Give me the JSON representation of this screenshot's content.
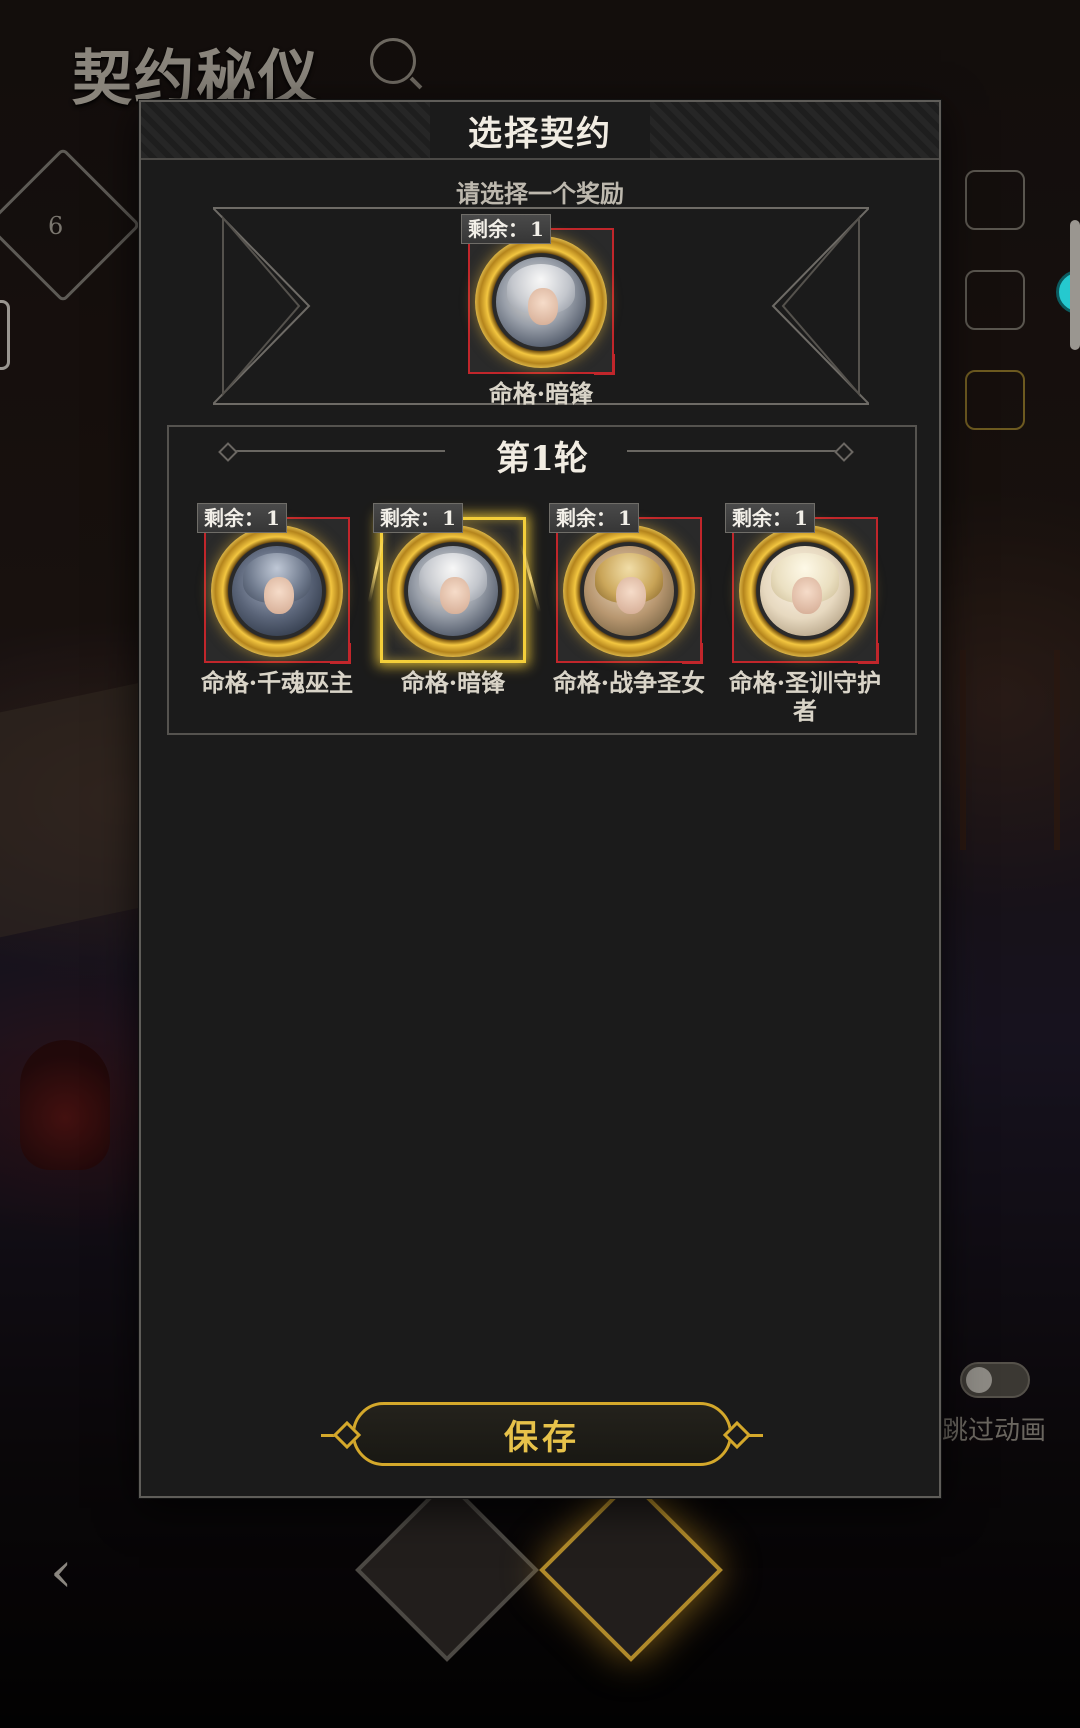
{
  "background": {
    "title": "契约秘仪",
    "emblem_number": "6",
    "skip_animation_label": "跳过动画"
  },
  "dialog": {
    "title": "选择契约",
    "prompt": "请选择一个奖励",
    "selected_reward": {
      "remaining_label": "剩余：",
      "remaining_value": "1",
      "name": "命格·暗锋"
    },
    "round": {
      "title": "第1轮",
      "options": [
        {
          "remaining_label": "剩余：",
          "remaining_value": "1",
          "name": "命格·千魂巫主",
          "icon": "portrait-dark-mage"
        },
        {
          "remaining_label": "剩余：",
          "remaining_value": "1",
          "name": "命格·暗锋",
          "icon": "portrait-silver-hair",
          "selected": true
        },
        {
          "remaining_label": "剩余：",
          "remaining_value": "1",
          "name": "命格·战争圣女",
          "icon": "portrait-war-maiden"
        },
        {
          "remaining_label": "剩余：",
          "remaining_value": "1",
          "name": "命格·圣训守护者",
          "icon": "portrait-holy-guardian"
        }
      ]
    },
    "save_label": "保存"
  },
  "colors": {
    "panel_bg": "#1b1b1b",
    "frame_red": "#c1262b",
    "gold": "#d4a82b",
    "selected_glow": "#f4cf3a"
  }
}
